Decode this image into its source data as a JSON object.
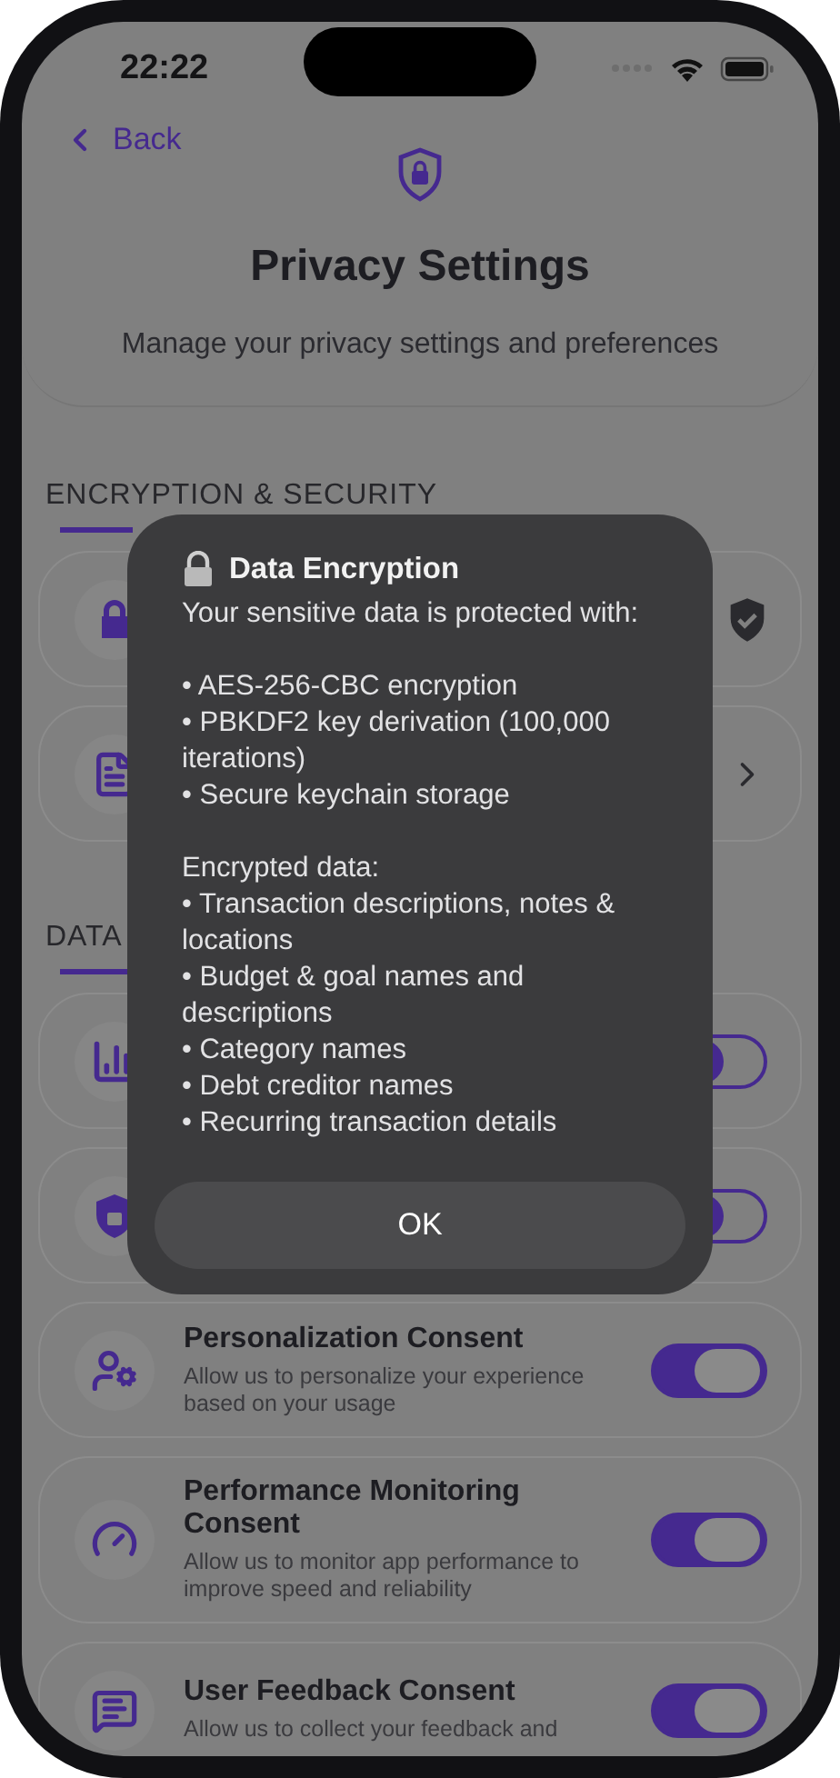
{
  "status_bar": {
    "time": "22:22"
  },
  "nav": {
    "back": "Back"
  },
  "header": {
    "title": "Privacy Settings",
    "subtitle": "Manage your privacy settings and preferences"
  },
  "sections": [
    {
      "title": "ENCRYPTION & SECURITY",
      "rows": [
        {
          "kind": "status"
        },
        {
          "kind": "link"
        }
      ]
    },
    {
      "title": "DATA",
      "rows": [
        {
          "kind": "toggle",
          "on": false
        },
        {
          "kind": "toggle",
          "on": false
        },
        {
          "kind": "toggle",
          "on": true,
          "title": "Personalization Consent",
          "description": "Allow us to personalize your experience based on your usage"
        },
        {
          "kind": "toggle",
          "on": true,
          "title": "Performance Monitoring Consent",
          "description": "Allow us to monitor app performance to improve speed and reliability"
        },
        {
          "kind": "toggle",
          "on": true,
          "title": "User Feedback Consent",
          "description": "Allow us to collect your feedback and"
        }
      ]
    }
  ],
  "dialog": {
    "title": "Data Encryption",
    "groups": [
      {
        "heading": "Your sensitive data is protected with:",
        "items": [
          "• AES-256-CBC encryption",
          "• PBKDF2 key derivation (100,000 iterations)",
          "• Secure keychain storage"
        ]
      },
      {
        "heading": "Encrypted data:",
        "items": [
          "• Transaction descriptions, notes & locations",
          "• Budget & goal names and descriptions",
          "• Category names",
          "• Debt creditor names",
          "• Recurring transaction details"
        ]
      }
    ],
    "button": "OK"
  }
}
